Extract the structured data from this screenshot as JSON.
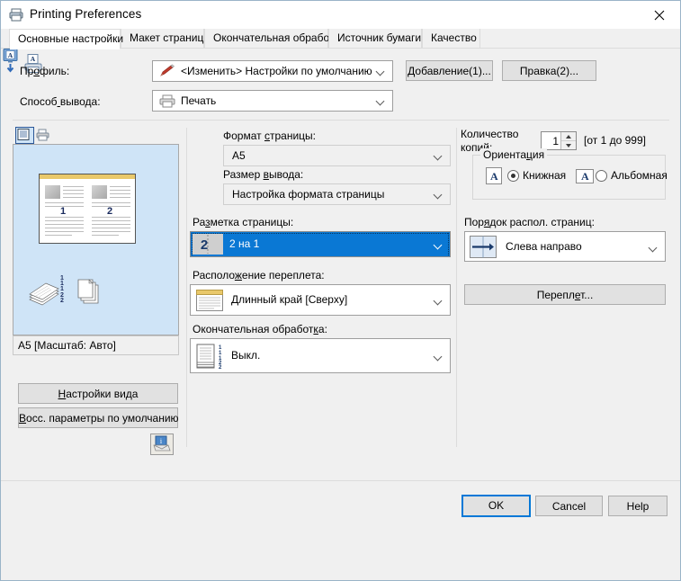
{
  "window": {
    "title": "Printing Preferences",
    "app_icon": "printer-icon",
    "close_label": "✕"
  },
  "tabs": [
    {
      "label": "Основные настройки",
      "active": true
    },
    {
      "label": "Макет страницы",
      "active": false
    },
    {
      "label": "Окончательная обработка",
      "active": false
    },
    {
      "label": "Источник бумаги",
      "active": false
    },
    {
      "label": "Качество",
      "active": false
    }
  ],
  "top": {
    "profile_label": "Профиль:",
    "profile_value": "<Изменить> Настройки по умолчанию",
    "profile_icon": "pencil-icon",
    "output_method_label": "Способ вывода:",
    "output_method_value": "Печать",
    "output_method_icon": "printer-small-icon",
    "add_button": "Добавление(1)...",
    "edit_button": "Правка(2)..."
  },
  "preview": {
    "tab_page_icon": "page-preview-icon",
    "tab_printer_icon": "printer-preview-icon",
    "status": "A5 [Масштаб: Авто]",
    "page_numbers": [
      "1",
      "2"
    ],
    "order_digits": [
      "1",
      "1",
      "1",
      "2",
      "2"
    ],
    "view_settings_button": "Настройки вида",
    "restore_defaults_button": "Восс. параметры по умолчанию",
    "info_icon": "info-box-icon"
  },
  "middle": {
    "page_size_label": "Формат страницы:",
    "page_size_value": "A5",
    "page_size_icon": "monitor-page-icon",
    "output_size_label": "Размер вывода:",
    "output_size_value": "Настройка формата страницы",
    "output_size_icon": "printer-page-icon",
    "page_layout_label": "Разметка страницы:",
    "page_layout_value": "2 на 1",
    "page_layout_icon": "2-up-icon",
    "page_layout_selected": true,
    "binding_label": "Расположение переплета:",
    "binding_value": "Длинный край [Сверху]",
    "binding_icon": "long-edge-top-icon",
    "finishing_label": "Окончательная обработка:",
    "finishing_value": "Выкл.",
    "finishing_icon": "collate-off-icon"
  },
  "right": {
    "copies_label_line1": "Количество",
    "copies_label_line2": "копий:",
    "copies_value": "1",
    "copies_range": "[от 1 до 999]",
    "orientation_group": "Ориентация",
    "orientation_portrait": "Книжная",
    "orientation_landscape": "Альбомная",
    "orientation_selected": "Книжная",
    "page_order_label": "Порядок распол. страниц:",
    "page_order_value": "Слева направо",
    "page_order_icon": "left-to-right-icon",
    "binding_button": "Переплет..."
  },
  "footer": {
    "ok": "OK",
    "cancel": "Cancel",
    "help": "Help"
  },
  "colors": {
    "accent_blue": "#0a78d4",
    "focus_blue": "#0078d7",
    "preview_bg": "#cfe4f7",
    "binding_bar": "#e9c86a"
  }
}
